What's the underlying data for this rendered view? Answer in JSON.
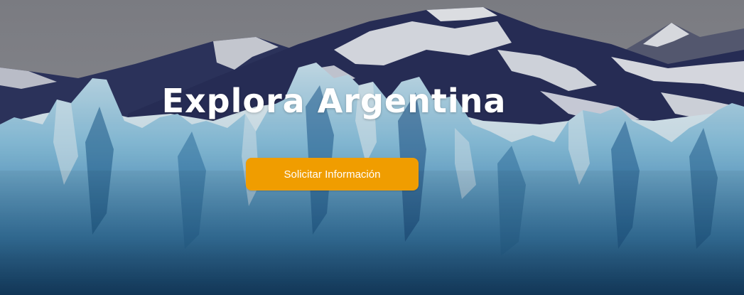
{
  "hero": {
    "title": "Explora Argentina",
    "cta_label": "Solicitar Información",
    "background": "glacier-mountains-image"
  },
  "colors": {
    "accent": "#f09d00",
    "title_text": "#ffffff",
    "button_text": "#ffffff",
    "sky": "#8d8e95",
    "mountain": "#2c3460",
    "snow": "#e6e8ee",
    "ice_light": "#c8e4f2",
    "ice_mid": "#6fb3d6",
    "ice_deep": "#1d5e92"
  }
}
